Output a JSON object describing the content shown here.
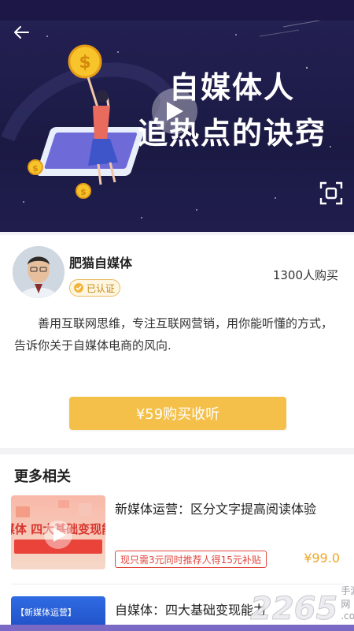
{
  "hero": {
    "title_line1": "自媒体人",
    "title_line2": "追热点的诀窍"
  },
  "author": {
    "name": "肥猫自媒体",
    "badge": "已认证",
    "buyers": "1300人购买"
  },
  "description": "善用互联网思维，专注互联网营销，用你能听懂的方式，告诉你关于自媒体电商的风向.",
  "buy_button": "¥59购买收听",
  "more": {
    "title": "更多相关",
    "items": [
      {
        "title": "新媒体运营：区分文字提高阅读体验",
        "thumb_text": "自媒体 四大基础变现能力",
        "promo": "现只需3元同时推荐人得15元补贴",
        "price": "¥99.0"
      },
      {
        "title": "自媒体：四大基础变现能力",
        "thumb_text": "【新媒体运营】"
      }
    ]
  },
  "watermark": {
    "logo": "2265",
    "sub": ".com",
    "site": "手游网"
  },
  "colors": {
    "hero_bg": "#1b1a44",
    "accent_yellow": "#f4c049",
    "price": "#f0a620",
    "promo_red": "#e2463d"
  }
}
